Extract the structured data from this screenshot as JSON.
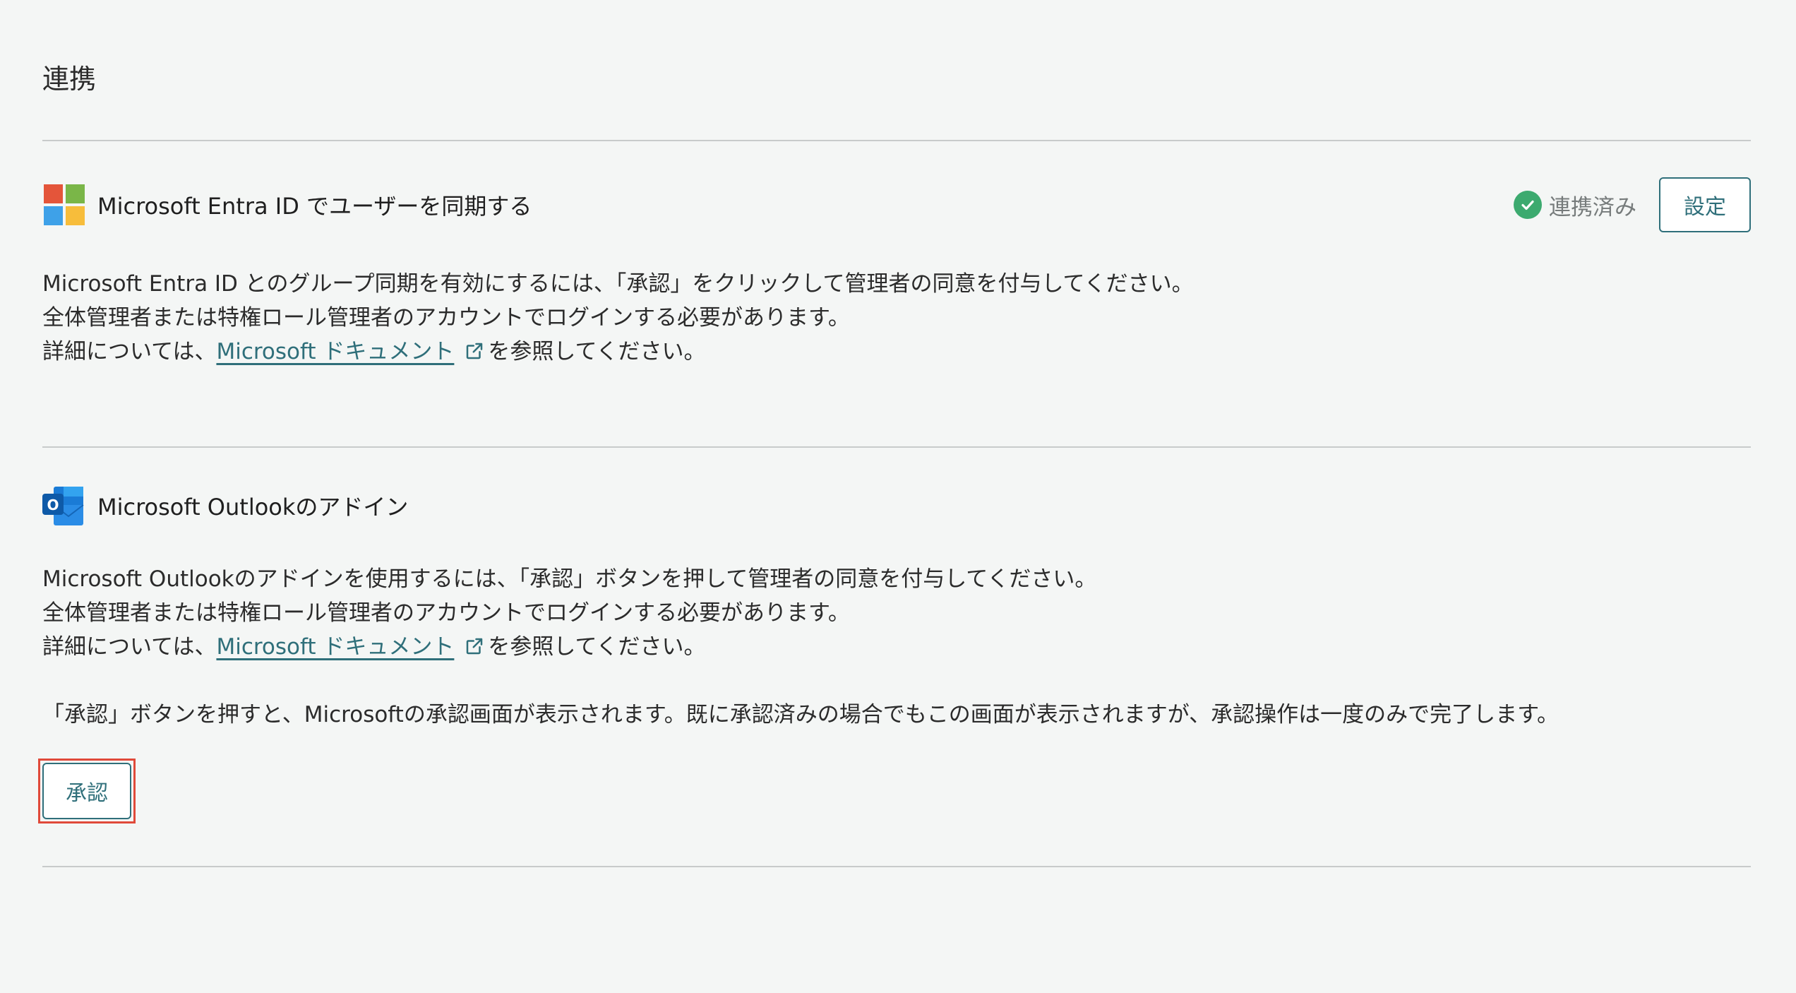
{
  "page": {
    "title": "連携"
  },
  "entra": {
    "title": "Microsoft Entra ID でユーザーを同期する",
    "status_label": "連携済み",
    "settings_label": "設定",
    "lines": [
      "Microsoft Entra ID とのグループ同期を有効にするには、「承認」をクリックして管理者の同意を付与してください。",
      "全体管理者または特権ロール管理者のアカウントでログインする必要があります。"
    ],
    "detail_prefix": "詳細については、",
    "link_text": "Microsoft ドキュメント",
    "detail_suffix": "を参照してください。"
  },
  "outlook": {
    "title": "Microsoft Outlookのアドイン",
    "lines": [
      "Microsoft Outlookのアドインを使用するには、「承認」ボタンを押して管理者の同意を付与してください。",
      "全体管理者または特権ロール管理者のアカウントでログインする必要があります。"
    ],
    "detail_prefix": "詳細については、",
    "link_text": "Microsoft ドキュメント",
    "detail_suffix": "を参照してください。",
    "note": "「承認」ボタンを押すと、Microsoftの承認画面が表示されます。既に承認済みの場合でもこの画面が表示されますが、承認操作は一度のみで完了します。",
    "approve_label": "承認"
  },
  "colors": {
    "background": "#f4f6f5",
    "accent": "#2f6f7a",
    "status_green": "#3caa6f",
    "highlight_red": "#e04a3a",
    "divider": "#c8cbcb"
  },
  "icons": {
    "entra": "microsoft-logo-icon",
    "outlook": "outlook-icon",
    "status": "check-circle-icon",
    "external_link": "external-link-icon"
  }
}
